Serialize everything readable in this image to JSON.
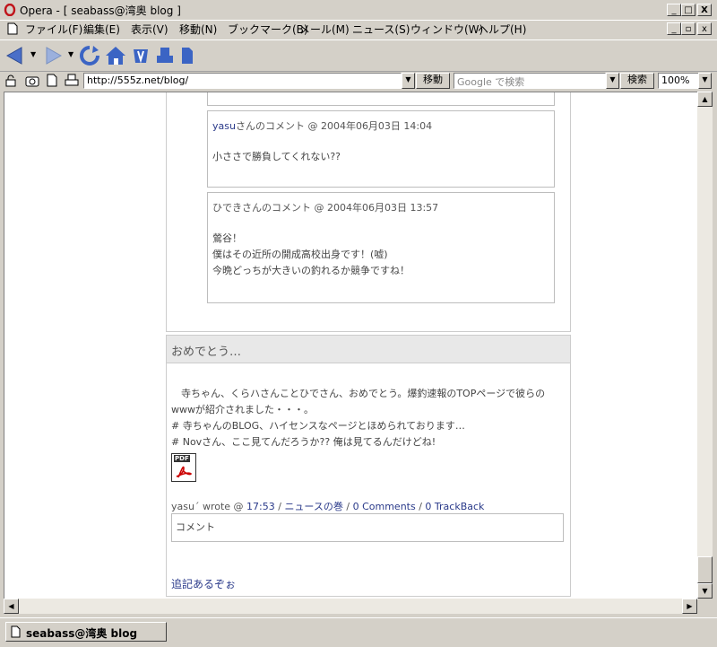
{
  "window": {
    "title": "Opera - [ seabass@湾奥 blog ]",
    "controls": [
      "_",
      "□",
      "X"
    ]
  },
  "menu": [
    "ファイル(F)",
    "編集(E)",
    "表示(V)",
    "移動(N)",
    "ブックマーク(B)",
    "メール(M)",
    "ニュース(S)",
    "ウィンドウ(W)",
    "ヘルプ(H)"
  ],
  "address": {
    "url": "http://555z.net/blog/",
    "go_label": "移動",
    "search_placeholder": "Google で検索",
    "search_label": "検索",
    "zoom": "100%"
  },
  "comments": [
    {
      "author": "yasu",
      "suffix": "さんのコメント @ 2004年06月03日 14:04",
      "lines": [
        "小ささで勝負してくれない??"
      ]
    },
    {
      "author": "ひでき",
      "suffix": "さんのコメント @ 2004年06月03日 13:57",
      "lines": [
        "鶯谷！",
        "僕はその近所の開成高校出身です！(嘘)",
        "今晩どっちが大きいの釣れるか競争ですね！"
      ]
    }
  ],
  "entry": {
    "title": "おめでとう…",
    "body": [
      "　寺ちゃん、くらハさんことひでさん、おめでとう。爆釣速報のTOPページで彼らの",
      "wwwが紹介されました・・・。",
      "# 寺ちゃんのBLOG、ハイセンスなページとほめられております…",
      "# Novさん、ここ見てんだろうか?? 俺は見てるんだけどね!"
    ],
    "pdf_label": "PDF",
    "meta_prefix": "yasu´ wrote @ ",
    "time": "17:53",
    "sep": " / ",
    "category": "ニュースの巻",
    "comments_link": "0 Comments",
    "trackback_link": "0 TrackBack",
    "comment_box": "コメント",
    "addendum": "追記あるぞぉ"
  },
  "tab": {
    "label": "seabass@湾奥 blog"
  },
  "colors": {
    "accent": "#2a3a8a",
    "header_bg": "#e8e8e8"
  }
}
